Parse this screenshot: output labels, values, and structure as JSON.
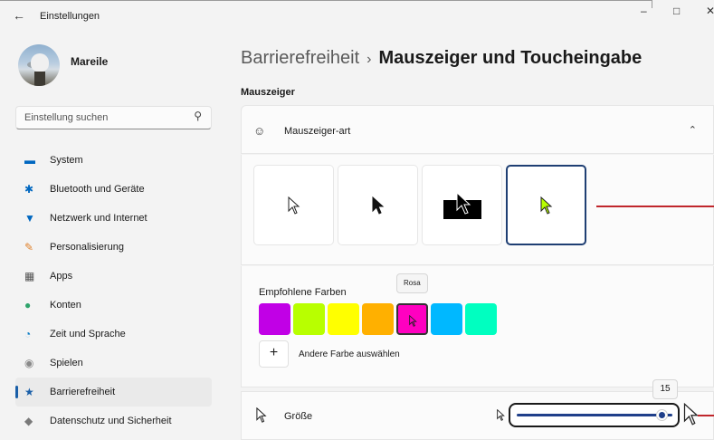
{
  "window": {
    "title": "Einstellungen",
    "controls": {
      "minimize": "–",
      "maximize": "□",
      "close": "✕"
    }
  },
  "profile": {
    "name": "Mareile"
  },
  "search": {
    "placeholder": "Einstellung suchen"
  },
  "nav": {
    "active_index": 8,
    "items": [
      {
        "label": "System",
        "icon": "system-icon",
        "color": "#0067c0"
      },
      {
        "label": "Bluetooth und Geräte",
        "icon": "bluetooth-icon",
        "color": "#0067c0"
      },
      {
        "label": "Netzwerk und Internet",
        "icon": "network-icon",
        "color": "#0067c0"
      },
      {
        "label": "Personalisierung",
        "icon": "pen-icon",
        "color": "#e0812a"
      },
      {
        "label": "Apps",
        "icon": "apps-icon",
        "color": "#555555"
      },
      {
        "label": "Konten",
        "icon": "person-icon",
        "color": "#2ea36b"
      },
      {
        "label": "Zeit und Sprache",
        "icon": "globe-clock-icon",
        "color": "#0f7fc7"
      },
      {
        "label": "Spielen",
        "icon": "gamepad-icon",
        "color": "#8a8a8a"
      },
      {
        "label": "Barrierefreiheit",
        "icon": "accessibility-icon",
        "color": "#1a5fa8"
      },
      {
        "label": "Datenschutz und Sicherheit",
        "icon": "shield-icon",
        "color": "#7a7a7a"
      }
    ]
  },
  "breadcrumb": {
    "parent": "Barrierefreiheit",
    "separator": "›",
    "current": "Mauszeiger und Toucheingabe"
  },
  "section": {
    "heading": "Mauszeiger"
  },
  "pointer_style": {
    "label": "Mauszeiger-art",
    "options": [
      "white-cursor-icon",
      "black-cursor-icon",
      "inverted-cursor-icon",
      "custom-color-cursor-icon"
    ],
    "selected_index": 3
  },
  "colors": {
    "label": "Empfohlene Farben",
    "swatches": [
      "#c100e6",
      "#b8ff00",
      "#ffff00",
      "#ffb000",
      "#ff00c0",
      "#00b8ff",
      "#00ffc0"
    ],
    "selected_index": 4,
    "tooltip": "Rosa",
    "custom_label": "Andere Farbe auswählen"
  },
  "size": {
    "label": "Größe",
    "value": "15",
    "level": 0.93
  },
  "accent": "#1f3f8a",
  "annotation_color": "#c0262c"
}
